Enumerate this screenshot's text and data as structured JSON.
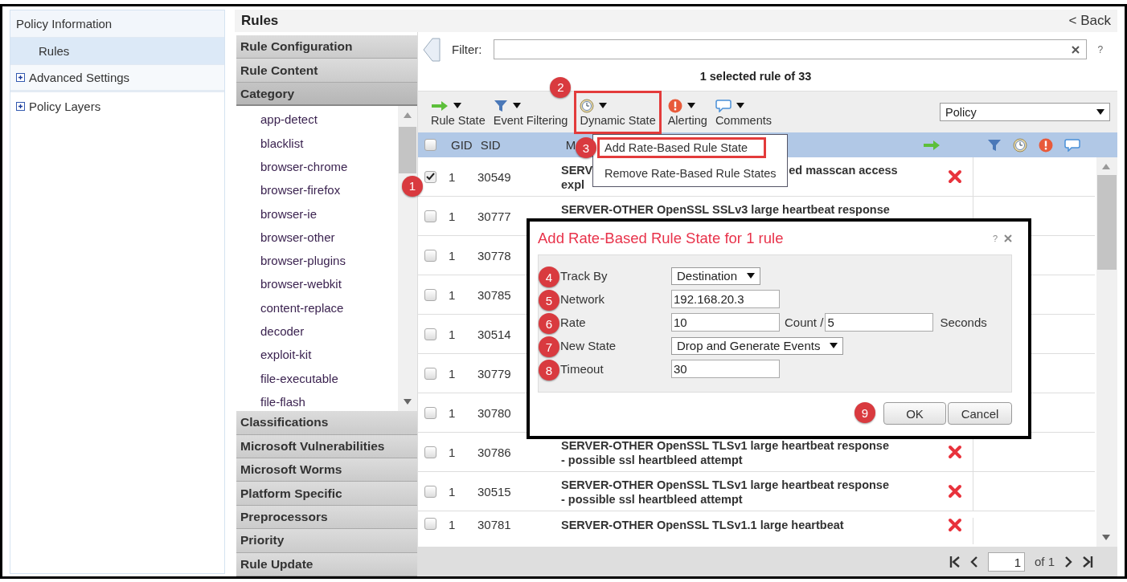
{
  "sidebar": {
    "items": [
      {
        "label": "Policy Information",
        "kind": "header",
        "selected": false
      },
      {
        "label": "Rules",
        "kind": "child",
        "selected": true
      },
      {
        "label": "Advanced Settings",
        "kind": "expandable",
        "selected": false
      },
      {
        "label": "Policy Layers",
        "kind": "expandable",
        "selected": false
      }
    ]
  },
  "header": {
    "title": "Rules",
    "back": "< Back"
  },
  "accordion": {
    "sections": [
      {
        "label": "Rule Configuration",
        "expanded": false
      },
      {
        "label": "Rule Content",
        "expanded": false
      },
      {
        "label": "Category",
        "expanded": true,
        "items": [
          "app-detect",
          "blacklist",
          "browser-chrome",
          "browser-firefox",
          "browser-ie",
          "browser-other",
          "browser-plugins",
          "browser-webkit",
          "content-replace",
          "decoder",
          "exploit-kit",
          "file-executable",
          "file-flash"
        ]
      },
      {
        "label": "Classifications",
        "expanded": false
      },
      {
        "label": "Microsoft Vulnerabilities",
        "expanded": false
      },
      {
        "label": "Microsoft Worms",
        "expanded": false
      },
      {
        "label": "Platform Specific",
        "expanded": false
      },
      {
        "label": "Preprocessors",
        "expanded": false
      },
      {
        "label": "Priority",
        "expanded": false
      },
      {
        "label": "Rule Update",
        "expanded": false
      }
    ]
  },
  "filter": {
    "label": "Filter:",
    "help": "?"
  },
  "selection_summary": "1 selected rule of 33",
  "toolbar": {
    "buttons": [
      {
        "label": "Rule State",
        "kind": "arrow",
        "highlighted": false
      },
      {
        "label": "Event Filtering",
        "kind": "funnel",
        "highlighted": false
      },
      {
        "label": "Dynamic State",
        "kind": "clock",
        "highlighted": true,
        "badge": "2"
      },
      {
        "label": "Alerting",
        "kind": "alert",
        "highlighted": false
      },
      {
        "label": "Comments",
        "kind": "comment",
        "highlighted": false
      }
    ],
    "view_select": "Policy"
  },
  "dropdown_menu": {
    "items": [
      {
        "label": "Add Rate-Based Rule State",
        "highlighted": true,
        "badge": "3"
      },
      {
        "label": "Remove Rate-Based Rule States",
        "highlighted": false
      }
    ]
  },
  "table": {
    "select_all": false,
    "columns": [
      "GID",
      "SID",
      "M"
    ],
    "rows": [
      {
        "checked": true,
        "gid": "1",
        "sid": "30549",
        "badge": "1",
        "message_lines": [
          [
            "SERV",
            "ed masscan access"
          ],
          [
            "expl"
          ]
        ],
        "dropped": true
      },
      {
        "checked": false,
        "gid": "1",
        "sid": "30777",
        "message_lines": [
          [
            "SERVER-OTHER OpenSSL SSLv3 large heartbeat response"
          ]
        ]
      },
      {
        "checked": false,
        "gid": "1",
        "sid": "30778"
      },
      {
        "checked": false,
        "gid": "1",
        "sid": "30785"
      },
      {
        "checked": false,
        "gid": "1",
        "sid": "30514"
      },
      {
        "checked": false,
        "gid": "1",
        "sid": "30779"
      },
      {
        "checked": false,
        "gid": "1",
        "sid": "30780"
      },
      {
        "checked": false,
        "gid": "1",
        "sid": "30786",
        "message_lines": [
          [
            "SERVER-OTHER OpenSSL TLSv1 large heartbeat response"
          ],
          [
            "- possible ssl heartbleed attempt"
          ]
        ],
        "dropped": true
      },
      {
        "checked": false,
        "gid": "1",
        "sid": "30515",
        "message_lines": [
          [
            "SERVER-OTHER OpenSSL TLSv1 large heartbeat response"
          ],
          [
            "- possible ssl heartbleed attempt"
          ]
        ],
        "dropped": true
      },
      {
        "checked": false,
        "gid": "1",
        "sid": "30781",
        "message_lines": [
          [
            "SERVER-OTHER OpenSSL TLSv1.1 large heartbeat"
          ]
        ],
        "dropped": true
      }
    ]
  },
  "pagination": {
    "page": "1",
    "of": "of 1"
  },
  "dialog": {
    "title": "Add Rate-Based Rule State for 1 rule",
    "help": "?",
    "fields": [
      {
        "label": "Track By",
        "kind": "select",
        "value": "Destination",
        "badge": "4"
      },
      {
        "label": "Network",
        "kind": "input",
        "value": "192.168.20.3",
        "badge": "5"
      },
      {
        "label": "Rate",
        "kind": "rate",
        "value": "10",
        "middle": "Count /",
        "value2": "5",
        "suffix": "Seconds",
        "badge": "6"
      },
      {
        "label": "New State",
        "kind": "select",
        "value": "Drop and Generate Events",
        "badge": "7"
      },
      {
        "label": "Timeout",
        "kind": "input",
        "value": "30",
        "badge": "8"
      }
    ],
    "buttons": [
      {
        "label": "OK",
        "badge": "9"
      },
      {
        "label": "Cancel"
      }
    ]
  }
}
